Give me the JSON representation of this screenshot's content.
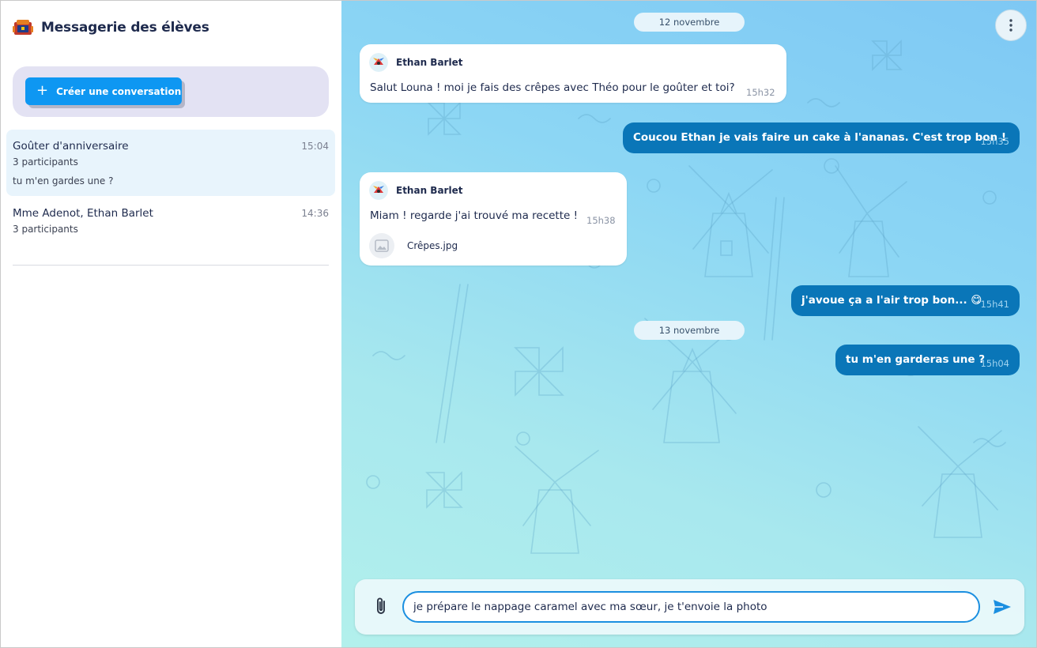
{
  "app": {
    "title": "Messagerie des élèves",
    "logo_icon": "school-bag-logo-icon"
  },
  "sidebar": {
    "create_button_label": "Créer une conversation",
    "conversations": [
      {
        "title": "Goûter d'anniversaire",
        "time": "15:04",
        "participants": "3 participants",
        "preview": "tu m'en gardes une ?",
        "active": true
      },
      {
        "title": "Mme Adenot, Ethan Barlet",
        "time": "14:36",
        "participants": "3 participants",
        "active": false
      }
    ]
  },
  "chat": {
    "dates": [
      "12 novembre",
      "13 novembre"
    ],
    "messages": [
      {
        "direction": "in",
        "sender": "Ethan Barlet",
        "text": "Salut Louna ! moi je fais des crêpes avec Théo pour le goûter et toi?",
        "time": "15h32"
      },
      {
        "direction": "out",
        "text": "Coucou Ethan je vais faire un cake à l'ananas. C'est trop bon !",
        "time": "15h35"
      },
      {
        "direction": "in",
        "sender": "Ethan Barlet",
        "text": "Miam ! regarde j'ai trouvé ma recette !",
        "time": "15h38",
        "attachment": "Crêpes.jpg"
      },
      {
        "direction": "out",
        "text": "j'avoue ça a l'air trop bon... 😋",
        "time": "15h41"
      },
      {
        "direction": "out",
        "text": "tu m'en garderas une ?",
        "time": "15h04"
      }
    ]
  },
  "composer": {
    "value": "je prépare le nappage caramel avec ma sœur, je t'envoie la photo"
  },
  "colors": {
    "primary_button": "#0e97f2",
    "outgoing_bubble": "#0a76b8",
    "active_conversation": "#e8f4fc",
    "input_border": "#1b8fe0"
  }
}
